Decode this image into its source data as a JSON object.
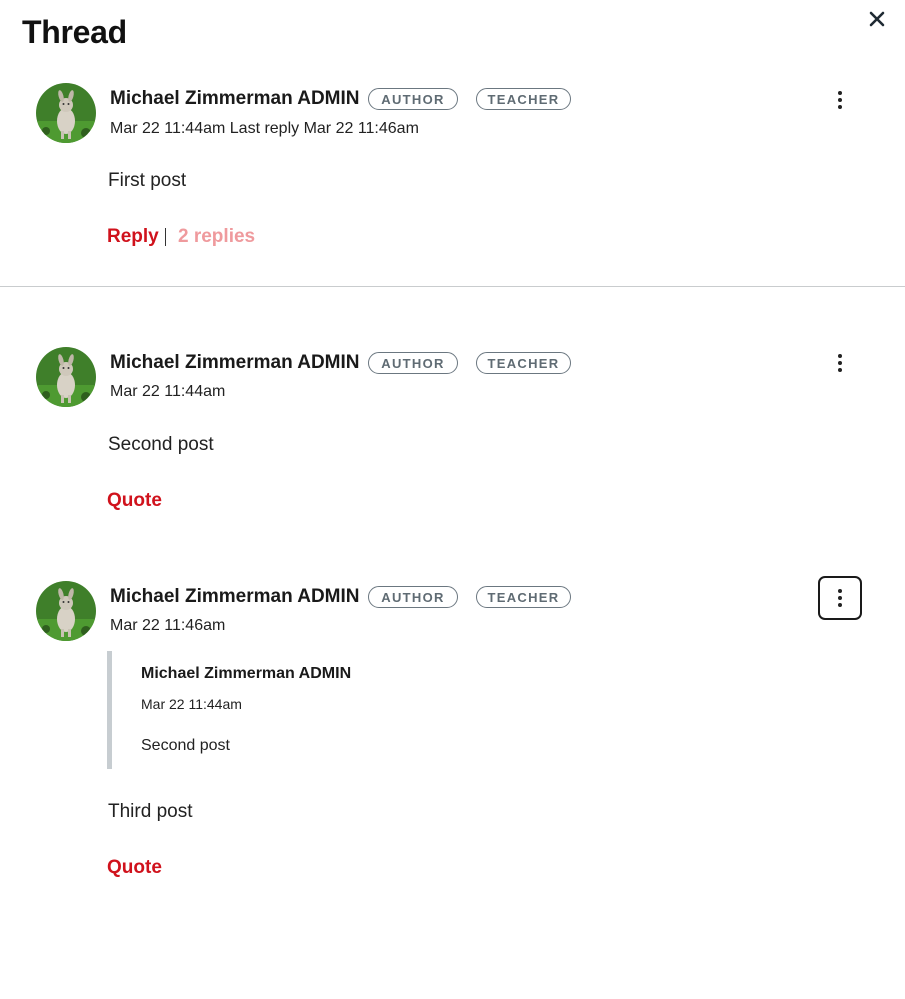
{
  "tray": {
    "title": "Thread",
    "close_icon": "close-icon"
  },
  "entries": [
    {
      "author": "Michael Zimmerman ADMIN",
      "badges": [
        "AUTHOR",
        "TEACHER"
      ],
      "meta": "Mar 22 11:44am  Last reply Mar 22 11:46am",
      "message": "First post",
      "reply_label": "Reply",
      "replies_label": "2 replies"
    },
    {
      "author": "Michael Zimmerman ADMIN",
      "badges": [
        "AUTHOR",
        "TEACHER"
      ],
      "meta": "Mar 22 11:44am",
      "message": "Second post",
      "quote_label": "Quote"
    },
    {
      "author": "Michael Zimmerman ADMIN",
      "badges": [
        "AUTHOR",
        "TEACHER"
      ],
      "meta": "Mar 22 11:46am",
      "quoted": {
        "author": "Michael Zimmerman ADMIN",
        "date": "Mar 22 11:44am",
        "message": "Second post"
      },
      "message": "Third post",
      "quote_label": "Quote"
    }
  ],
  "colors": {
    "link_red": "#d0121c",
    "link_red_light": "#ef9a9d",
    "pill_border": "#6b7780",
    "quote_bar": "#c7cdd1",
    "divider": "#c9ccce"
  }
}
